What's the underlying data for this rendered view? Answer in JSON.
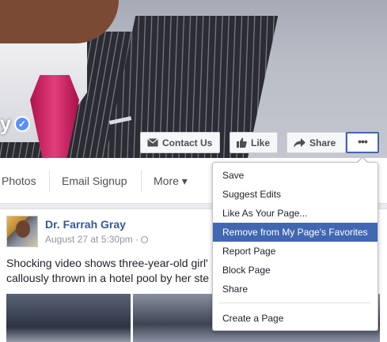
{
  "cover": {
    "name_fragment": "y"
  },
  "actions": {
    "contact": "Contact Us",
    "like": "Like",
    "share": "Share",
    "more": "•••"
  },
  "nav": {
    "photos": "Photos",
    "email_signup": "Email Signup",
    "more": "More ▾"
  },
  "post": {
    "author": "Dr. Farrah Gray",
    "timestamp": "August 27 at 5:30pm · ",
    "globe": "🌐",
    "text_line1": "Shocking video shows three-year-old girl'",
    "text_line2": "callously thrown in a hotel pool by her ste"
  },
  "menu": {
    "items": [
      {
        "label": "Save",
        "active": false
      },
      {
        "label": "Suggest Edits",
        "active": false
      },
      {
        "label": "Like As Your Page...",
        "active": false
      },
      {
        "label": "Remove from My Page's Favorites",
        "active": true
      },
      {
        "label": "Report Page",
        "active": false
      },
      {
        "label": "Block Page",
        "active": false
      },
      {
        "label": "Share",
        "active": false
      }
    ],
    "footer_item": "Create a Page"
  },
  "colors": {
    "accent": "#4267b2",
    "link": "#365899",
    "verified": "#5890ff"
  },
  "icons": {
    "verified": "verified-badge-icon",
    "contact": "envelope-icon",
    "like": "thumbs-up-icon",
    "share": "share-arrow-icon",
    "more": "more-dots-icon",
    "globe": "globe-icon",
    "nav_more": "caret-down-icon"
  }
}
